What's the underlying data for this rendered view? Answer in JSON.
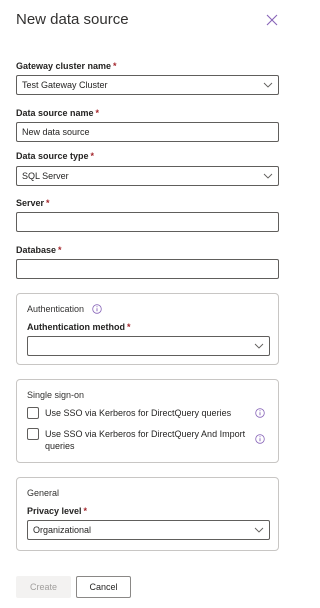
{
  "dialog": {
    "title": "New data source",
    "close_icon": "close-icon"
  },
  "fields": {
    "gateway": {
      "label": "Gateway cluster name",
      "required": "*",
      "value": "Test Gateway Cluster"
    },
    "datasource_name": {
      "label": "Data source name",
      "required": "*",
      "value": "New data source"
    },
    "datasource_type": {
      "label": "Data source type",
      "required": "*",
      "value": "SQL Server"
    },
    "server": {
      "label": "Server",
      "required": "*",
      "value": ""
    },
    "database": {
      "label": "Database",
      "required": "*",
      "value": ""
    }
  },
  "authentication": {
    "title": "Authentication",
    "method_label": "Authentication method",
    "required": "*",
    "method_value": ""
  },
  "sso": {
    "title": "Single sign-on",
    "options": [
      {
        "label": "Use SSO via Kerberos for DirectQuery queries"
      },
      {
        "label_line1": "Use SSO via Kerberos for DirectQuery And Import",
        "label_line2": "queries"
      }
    ]
  },
  "general": {
    "title": "General",
    "privacy_label": "Privacy level",
    "required": "*",
    "privacy_value": "Organizational"
  },
  "buttons": {
    "create": "Create",
    "cancel": "Cancel"
  },
  "colors": {
    "required": "#a4262c",
    "info_icon": "#8764b8",
    "close_icon": "#8764b8"
  }
}
